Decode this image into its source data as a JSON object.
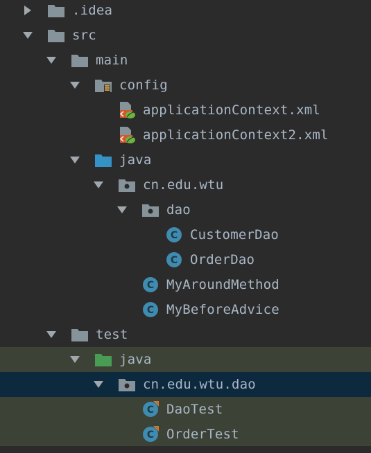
{
  "tree": [
    {
      "id": "idea",
      "label": ".idea",
      "depth": 0,
      "expanded": false,
      "icon": "folder-icon",
      "iconColor": "#87939a"
    },
    {
      "id": "src",
      "label": "src",
      "depth": 0,
      "expanded": true,
      "icon": "folder-icon",
      "iconColor": "#87939a"
    },
    {
      "id": "main",
      "label": "main",
      "depth": 1,
      "expanded": true,
      "icon": "folder-icon",
      "iconColor": "#87939a"
    },
    {
      "id": "config",
      "label": "config",
      "depth": 2,
      "expanded": true,
      "icon": "resource-folder-icon",
      "iconColor": "#87939a"
    },
    {
      "id": "appctx",
      "label": "applicationContext.xml",
      "depth": 3,
      "leaf": true,
      "icon": "spring-xml-icon"
    },
    {
      "id": "appctx2",
      "label": "applicationContext2.xml",
      "depth": 3,
      "leaf": true,
      "icon": "spring-xml-icon"
    },
    {
      "id": "java-main",
      "label": "java",
      "depth": 2,
      "expanded": true,
      "icon": "source-folder-icon",
      "iconColor": "#3592c4"
    },
    {
      "id": "pkg-wtu",
      "label": "cn.edu.wtu",
      "depth": 3,
      "expanded": true,
      "icon": "package-icon",
      "iconColor": "#87939a"
    },
    {
      "id": "pkg-dao",
      "label": "dao",
      "depth": 4,
      "expanded": true,
      "icon": "package-icon",
      "iconColor": "#87939a"
    },
    {
      "id": "customerdao",
      "label": "CustomerDao",
      "depth": 5,
      "leaf": true,
      "icon": "class-icon"
    },
    {
      "id": "orderdao",
      "label": "OrderDao",
      "depth": 5,
      "leaf": true,
      "icon": "class-icon"
    },
    {
      "id": "myaround",
      "label": "MyAroundMethod",
      "depth": 4,
      "leaf": true,
      "icon": "class-icon"
    },
    {
      "id": "mybefore",
      "label": "MyBeforeAdvice",
      "depth": 4,
      "leaf": true,
      "icon": "class-icon"
    },
    {
      "id": "test",
      "label": "test",
      "depth": 1,
      "expanded": true,
      "icon": "folder-icon",
      "iconColor": "#87939a"
    },
    {
      "id": "java-test",
      "label": "java",
      "depth": 2,
      "expanded": true,
      "icon": "test-source-folder-icon",
      "iconColor": "#499c54",
      "highlight": "green"
    },
    {
      "id": "pkg-test",
      "label": "cn.edu.wtu.dao",
      "depth": 3,
      "expanded": true,
      "icon": "package-icon",
      "iconColor": "#87939a",
      "highlight": "selected"
    },
    {
      "id": "daotest",
      "label": "DaoTest",
      "depth": 4,
      "leaf": true,
      "icon": "test-class-icon",
      "highlight": "green"
    },
    {
      "id": "ordertest",
      "label": "OrderTest",
      "depth": 4,
      "leaf": true,
      "icon": "test-class-icon",
      "highlight": "green"
    }
  ],
  "colors": {
    "background": "#2b2b2b",
    "text": "#a9b7c6",
    "greenHighlight": "#3d4236",
    "selectedHighlight": "#0d293e",
    "classIcon": "#3f8cb0",
    "arrow": "#a0a8ad"
  }
}
